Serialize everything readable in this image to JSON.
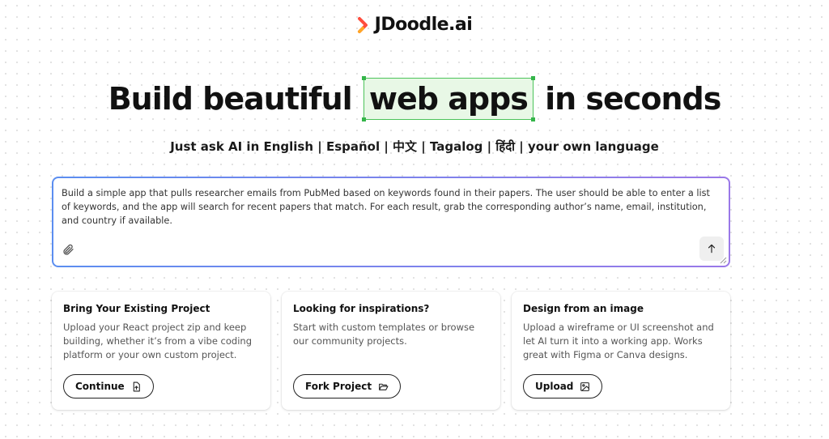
{
  "brand": {
    "name": "JDoodle.ai",
    "mark_colors": [
      "#ff4d3d",
      "#ffa726"
    ]
  },
  "hero": {
    "title_before": "Build beautiful",
    "title_highlight": "web apps",
    "title_after": "in seconds",
    "highlight_color": "#e8f8e6",
    "highlight_border": "#4cc35a"
  },
  "subtitle": "Just ask AI in English | Español | 中文 | Tagalog | हिंदी | your own language",
  "prompt": {
    "value": "Build a simple app that pulls researcher emails from PubMed based on keywords found in their papers. The user should be able to enter a list of keywords, and the app will search for recent papers that match. For each result, grab the corresponding author’s name, email, institution, and country if available.",
    "attach_icon": "paperclip-icon",
    "send_icon": "arrow-up-icon",
    "border_gradient": [
      "#5b8ef0",
      "#9a78e8"
    ]
  },
  "cards": [
    {
      "title": "Bring Your Existing Project",
      "description": "Upload your React project zip and keep building, whether it’s from a vibe coding platform or your own custom project.",
      "button_label": "Continue",
      "button_icon": "file-upload-icon"
    },
    {
      "title": "Looking for inspirations?",
      "description": "Start with custom templates or browse our community projects.",
      "button_label": "Fork Project",
      "button_icon": "folder-open-icon"
    },
    {
      "title": "Design from an image",
      "description": "Upload a wireframe or UI screenshot and let AI turn it into a working app. Works great with Figma or Canva designs.",
      "button_label": "Upload",
      "button_icon": "image-icon"
    }
  ]
}
